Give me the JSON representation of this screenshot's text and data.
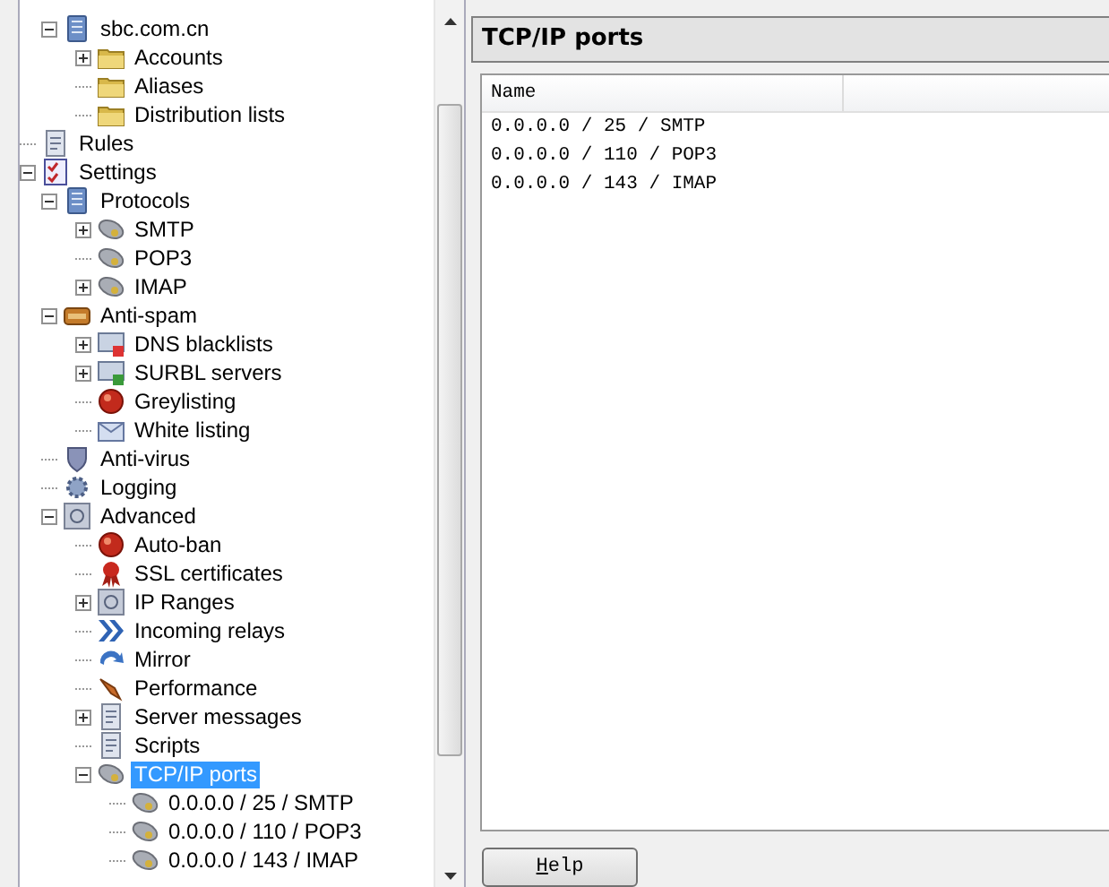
{
  "tree": [
    {
      "children": [
        {
          "label": "sbc.com.cn",
          "kind": "domain",
          "selected": false,
          "expanded": true,
          "children": [
            {
              "label": "Accounts",
              "kind": "folder",
              "selected": false,
              "expanded": false
            },
            {
              "label": "Aliases",
              "kind": "folder",
              "selected": false
            },
            {
              "label": "Distribution lists",
              "kind": "folder",
              "selected": false
            }
          ]
        }
      ]
    },
    {
      "label": "Rules",
      "kind": "rules",
      "selected": false
    },
    {
      "label": "Settings",
      "kind": "settings",
      "selected": false,
      "expanded": true,
      "children": [
        {
          "label": "Protocols",
          "kind": "protocols",
          "selected": false,
          "expanded": true,
          "children": [
            {
              "label": "SMTP",
              "kind": "port",
              "selected": false,
              "expanded": false
            },
            {
              "label": "POP3",
              "kind": "port",
              "selected": false
            },
            {
              "label": "IMAP",
              "kind": "port",
              "selected": false,
              "expanded": false
            }
          ]
        },
        {
          "label": "Anti-spam",
          "kind": "antispam",
          "selected": false,
          "expanded": true,
          "children": [
            {
              "label": "DNS blacklists",
              "kind": "dns",
              "selected": false,
              "expanded": false
            },
            {
              "label": "SURBL servers",
              "kind": "surbl",
              "selected": false,
              "expanded": false
            },
            {
              "label": "Greylisting",
              "kind": "ball",
              "selected": false
            },
            {
              "label": "White listing",
              "kind": "envelope",
              "selected": false
            }
          ]
        },
        {
          "label": "Anti-virus",
          "kind": "shield",
          "selected": false
        },
        {
          "label": "Logging",
          "kind": "logging",
          "selected": false
        },
        {
          "label": "Advanced",
          "kind": "advanced",
          "selected": false,
          "expanded": true,
          "children": [
            {
              "label": "Auto-ban",
              "kind": "ball",
              "selected": false
            },
            {
              "label": "SSL certificates",
              "kind": "ribbon",
              "selected": false
            },
            {
              "label": "IP Ranges",
              "kind": "iprange",
              "selected": false,
              "expanded": false
            },
            {
              "label": "Incoming relays",
              "kind": "relay",
              "selected": false
            },
            {
              "label": "Mirror",
              "kind": "mirror",
              "selected": false
            },
            {
              "label": "Performance",
              "kind": "performance",
              "selected": false
            },
            {
              "label": "Server messages",
              "kind": "document",
              "selected": false,
              "expanded": false
            },
            {
              "label": "Scripts",
              "kind": "scripts",
              "selected": false
            },
            {
              "label": "TCP/IP ports",
              "kind": "port",
              "selected": true,
              "expanded": true,
              "children": [
                {
                  "label": "0.0.0.0 / 25 / SMTP",
                  "kind": "port",
                  "selected": false
                },
                {
                  "label": "0.0.0.0 / 110 / POP3",
                  "kind": "port",
                  "selected": false
                },
                {
                  "label": "0.0.0.0 / 143 / IMAP",
                  "kind": "port",
                  "selected": false
                }
              ]
            }
          ]
        }
      ]
    }
  ],
  "panel": {
    "title": "TCP/IP ports",
    "columns": [
      "Name"
    ],
    "rows": [
      "0.0.0.0 / 25 / SMTP",
      "0.0.0.0 / 110 / POP3",
      "0.0.0.0 / 143 / IMAP"
    ],
    "buttons": [
      "Help"
    ]
  }
}
